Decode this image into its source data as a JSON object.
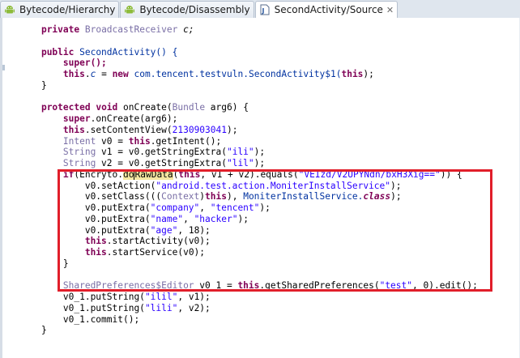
{
  "tabs": [
    {
      "label": "Bytecode/Hierarchy",
      "icon": "android-icon",
      "active": false
    },
    {
      "label": "Bytecode/Disassembly",
      "icon": "android-icon",
      "active": false
    },
    {
      "label": "SecondActivity/Source",
      "icon": "java-file-icon",
      "active": true
    }
  ],
  "tab_close_glyph": "✕",
  "colors": {
    "keyword": "#7f0055",
    "type": "#7a6fa6",
    "package": "#0032a0",
    "string": "#2a00ff",
    "highlight_box": "#e11e2a"
  },
  "code": {
    "l1": {
      "kw": "private",
      "type": "BroadcastReceiver",
      "rest": " c;"
    },
    "l3": {
      "kw": "public",
      "name": " SecondActivity() {"
    },
    "l4": "super();",
    "l5": {
      "kw": "this",
      "field": "c",
      "op": " = ",
      "kw2": "new",
      "pkg": " com.tencent.testvuln.SecondActivity$1(",
      "kw3": "this",
      "end": ");"
    },
    "l6": "}",
    "l8": {
      "kw": "protected",
      "kw2": "void",
      "name": " onCreate(",
      "type": "Bundle",
      "rest": " arg6) {"
    },
    "l9": {
      "kw": "super",
      "rest": ".onCreate(arg6);"
    },
    "l10": {
      "kw": "this",
      "rest": ".setContentView(",
      "num": "2130903041",
      "end": ");"
    },
    "l11": {
      "type": "Intent",
      "rest": " v0 = ",
      "kw": "this",
      "end": ".getIntent();"
    },
    "l12": {
      "type": "String",
      "rest": " v1 = v0.getStringExtra(",
      "str": "\"ili\"",
      "end": ");"
    },
    "l13": {
      "type": "String",
      "rest": " v2 = v0.getStringExtra(",
      "str": "\"lil\"",
      "end": ");"
    },
    "l14": {
      "kw": "if",
      "a": "(Encryto.",
      "b": "do",
      "c": "Raw",
      "d": "Data",
      "e": "(",
      "kw2": "this",
      "f": ", v1 + v2).equals(",
      "str": "\"VEIzd/V2UPYNdn/bxH3Xig==\"",
      "end": ")) {"
    },
    "l15": {
      "rest": "v0.setAction(",
      "str": "\"android.test.action.MoniterInstallService\"",
      "end": ");"
    },
    "l16": {
      "a": "v0.setClass(((",
      "type": "Context",
      "b": ")",
      "kw": "this",
      "c": "), ",
      "pkg": "MoniterInstallService.",
      "kw2": "class",
      "end": ");"
    },
    "l17": {
      "rest": "v0.putExtra(",
      "str": "\"company\"",
      "sep": ", ",
      "str2": "\"tencent\"",
      "end": ");"
    },
    "l18": {
      "rest": "v0.putExtra(",
      "str": "\"name\"",
      "sep": ", ",
      "str2": "\"hacker\"",
      "end": ");"
    },
    "l19": {
      "rest": "v0.putExtra(",
      "str": "\"age\"",
      "sep": ", ",
      "num": "18",
      "end": ");"
    },
    "l20": {
      "kw": "this",
      "rest": ".startActivity(v0);"
    },
    "l21": {
      "kw": "this",
      "rest": ".startService(v0);"
    },
    "l22": "}",
    "l24": {
      "type": "SharedPreferences$Editor",
      "rest": " v0_1 = ",
      "kw": "this",
      "a": ".getSharedPreferences(",
      "str": "\"test\"",
      "b": ", ",
      "num": "0",
      "end": ").edit();"
    },
    "l25": {
      "rest": "v0_1.putString(",
      "str": "\"ilil\"",
      "end": ", v1);"
    },
    "l26": {
      "rest": "v0_1.putString(",
      "str": "\"lili\"",
      "end": ", v2);"
    },
    "l27": "v0_1.commit();",
    "l28": "}"
  }
}
